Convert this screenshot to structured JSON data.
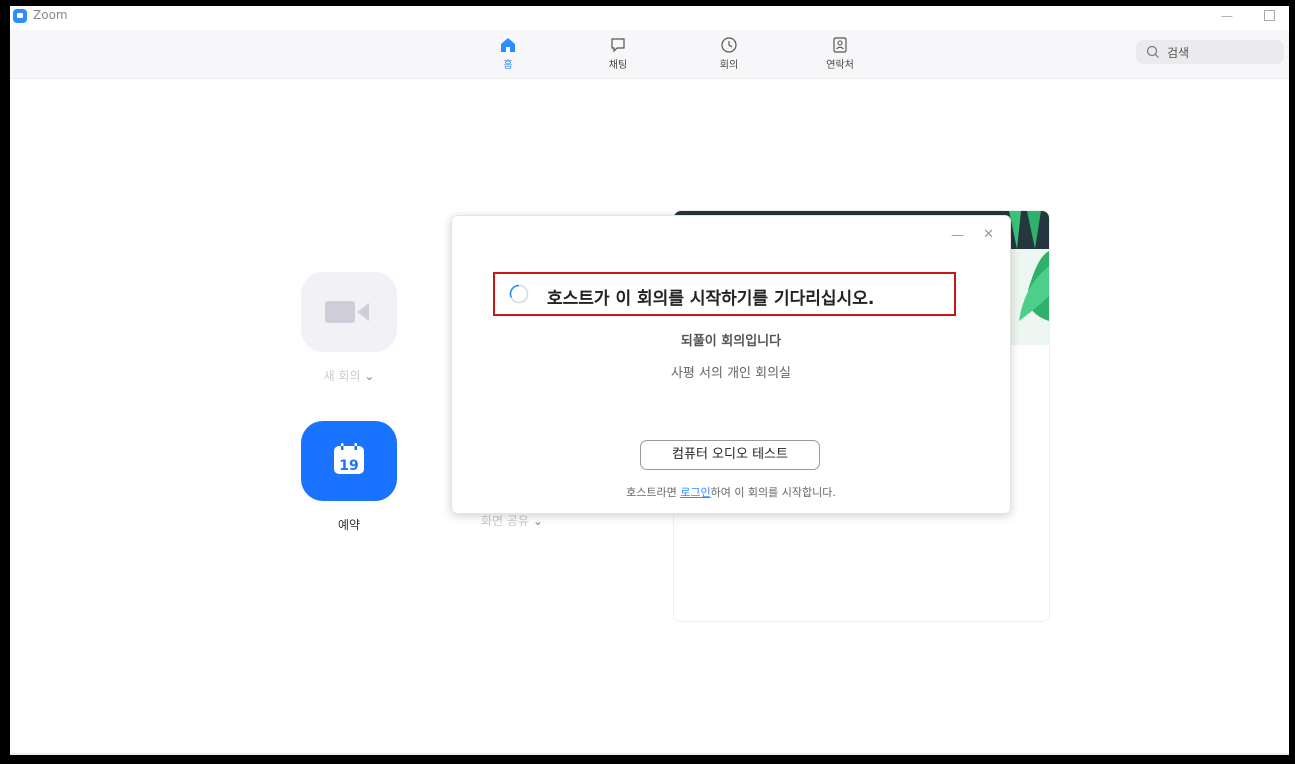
{
  "app": {
    "title": "Zoom"
  },
  "nav": {
    "tabs": [
      {
        "label": "홈",
        "icon": "home-icon",
        "active": true
      },
      {
        "label": "채팅",
        "icon": "chat-icon",
        "active": false
      },
      {
        "label": "회의",
        "icon": "clock-icon",
        "active": false
      },
      {
        "label": "연락처",
        "icon": "contacts-icon",
        "active": false
      }
    ],
    "search_placeholder": "검색"
  },
  "home": {
    "new_meeting_label": "새 회의",
    "schedule_label": "예약",
    "calendar_day": "19",
    "share_screen_label": "화면 공유"
  },
  "dialog": {
    "wait_text": "호스트가 이 회의를 시작하기를 기다리십시오.",
    "meeting_title": "되풀이 회의입니다",
    "meeting_room": "사평 서의 개인 회의실",
    "audio_test_button": "컴퓨터 오디오 테스트",
    "host_prefix": "호스트라면 ",
    "login_link": "로그인",
    "host_suffix": "하여 이 회의를 시작합니다."
  },
  "colors": {
    "accent": "#2d8cff",
    "highlight_border": "#c8161b"
  }
}
